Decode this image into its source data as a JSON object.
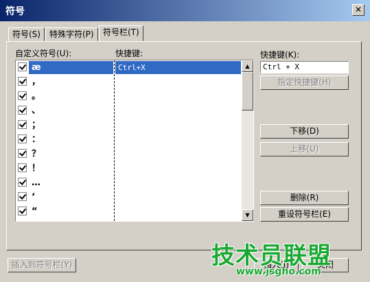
{
  "window": {
    "title": "符号",
    "close_glyph": "✕"
  },
  "tabs": [
    {
      "label": "符号(S)"
    },
    {
      "label": "特殊字符(P)"
    },
    {
      "label": "符号栏(T)"
    }
  ],
  "symbol_list": {
    "header_symbol": "自定义符号(U):",
    "header_shortcut": "快捷键:",
    "rows": [
      {
        "symbol": "æ",
        "shortcut": "Ctrl+X",
        "checked": true
      },
      {
        "symbol": "，",
        "shortcut": "",
        "checked": true
      },
      {
        "symbol": "。",
        "shortcut": "",
        "checked": true
      },
      {
        "symbol": "、",
        "shortcut": "",
        "checked": true
      },
      {
        "symbol": "；",
        "shortcut": "",
        "checked": true
      },
      {
        "symbol": "：",
        "shortcut": "",
        "checked": true
      },
      {
        "symbol": "？",
        "shortcut": "",
        "checked": true
      },
      {
        "symbol": "！",
        "shortcut": "",
        "checked": true
      },
      {
        "symbol": "…",
        "shortcut": "",
        "checked": true
      },
      {
        "symbol": "‘",
        "shortcut": "",
        "checked": true
      },
      {
        "symbol": "“",
        "shortcut": "",
        "checked": true
      }
    ]
  },
  "shortcut_panel": {
    "label": "快捷键(K):",
    "value": "Ctrl + X",
    "assign_button": "指定快捷键(H)",
    "move_down_button": "下移(D)",
    "move_up_button": "上移(U)",
    "delete_button": "删除(R)",
    "reset_button": "重设符号栏(E)"
  },
  "bottom": {
    "insert_to_bar_button": "插入到符号栏(Y)",
    "insert_button": "插入(I)",
    "close_button": "关闭"
  },
  "watermark": {
    "text": "技术员联盟",
    "url": "www.jsgho.com"
  },
  "colors": {
    "title_start": "#0a246a",
    "title_end": "#a6caf0",
    "selection": "#316ac5",
    "watermark": "#19a832"
  }
}
